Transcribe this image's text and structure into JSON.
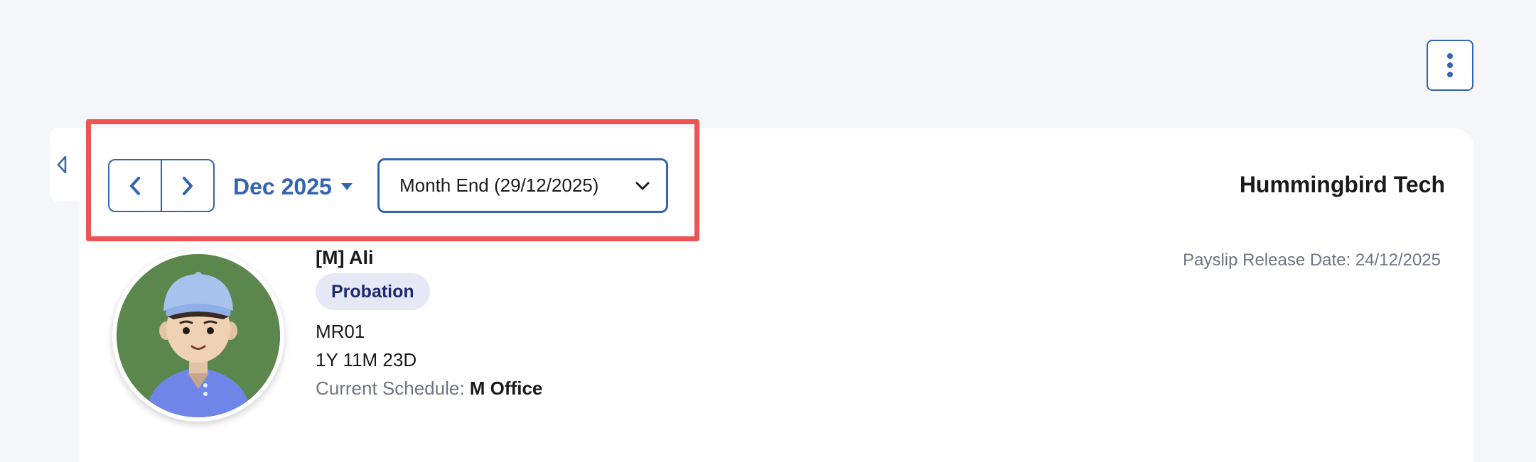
{
  "toolbar": {
    "more_icon": "vertical-dots-icon"
  },
  "period_nav": {
    "prev_icon": "chevron-left-icon",
    "next_icon": "chevron-right-icon",
    "month_label": "Dec 2025",
    "period_value": "Month End (29/12/2025)"
  },
  "company": {
    "name": "Hummingbird Tech"
  },
  "payslip": {
    "release_date": "Payslip Release Date: 24/12/2025"
  },
  "employee": {
    "name": "[M] Ali",
    "status": "Probation",
    "code": "MR01",
    "tenure": "1Y 11M 23D",
    "schedule_label": "Current Schedule:",
    "schedule_value": "M Office"
  },
  "colors": {
    "accent": "#3464b0",
    "highlight": "#ef5354",
    "badge_bg": "#e6e8f5"
  }
}
